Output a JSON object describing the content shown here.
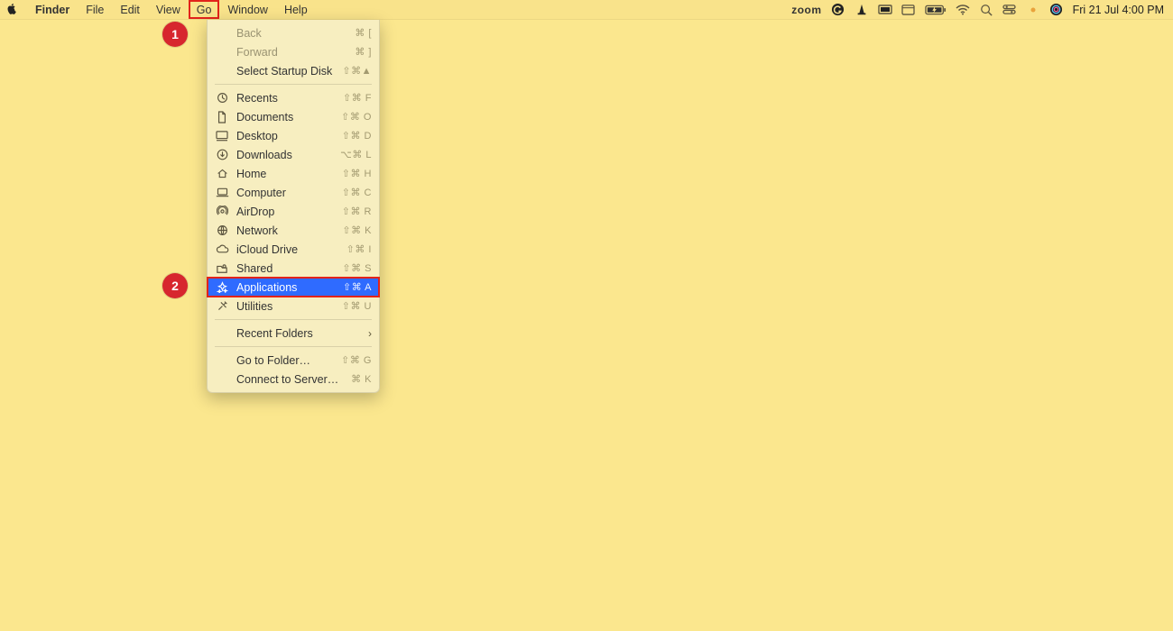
{
  "menubar": {
    "app": "Finder",
    "items": [
      "File",
      "Edit",
      "View",
      "Go",
      "Window",
      "Help"
    ],
    "status": {
      "zoom": "zoom",
      "clock": "Fri 21 Jul  4:00 PM"
    }
  },
  "dropdown": {
    "items": [
      {
        "label": "Back",
        "shortcut": "⌘ [",
        "icon": "",
        "disabled": true
      },
      {
        "label": "Forward",
        "shortcut": "⌘ ]",
        "icon": "",
        "disabled": true
      },
      {
        "label": "Select Startup Disk",
        "shortcut": "⇧⌘▲",
        "icon": ""
      },
      {
        "sep": true
      },
      {
        "label": "Recents",
        "shortcut": "⇧⌘ F",
        "icon": "clock"
      },
      {
        "label": "Documents",
        "shortcut": "⇧⌘ O",
        "icon": "doc"
      },
      {
        "label": "Desktop",
        "shortcut": "⇧⌘ D",
        "icon": "desktop"
      },
      {
        "label": "Downloads",
        "shortcut": "⌥⌘ L",
        "icon": "download"
      },
      {
        "label": "Home",
        "shortcut": "⇧⌘ H",
        "icon": "home"
      },
      {
        "label": "Computer",
        "shortcut": "⇧⌘ C",
        "icon": "laptop"
      },
      {
        "label": "AirDrop",
        "shortcut": "⇧⌘ R",
        "icon": "airdrop"
      },
      {
        "label": "Network",
        "shortcut": "⇧⌘ K",
        "icon": "globe"
      },
      {
        "label": "iCloud Drive",
        "shortcut": "⇧⌘ I",
        "icon": "cloud"
      },
      {
        "label": "Shared",
        "shortcut": "⇧⌘ S",
        "icon": "shared"
      },
      {
        "label": "Applications",
        "shortcut": "⇧⌘ A",
        "icon": "apps",
        "selected": true,
        "outlined": true
      },
      {
        "label": "Utilities",
        "shortcut": "⇧⌘ U",
        "icon": "tools"
      },
      {
        "sep": true
      },
      {
        "label": "Recent Folders",
        "shortcut": "",
        "icon": "",
        "submenu": true
      },
      {
        "sep": true
      },
      {
        "label": "Go to Folder…",
        "shortcut": "⇧⌘ G",
        "icon": ""
      },
      {
        "label": "Connect to Server…",
        "shortcut": "⌘ K",
        "icon": ""
      }
    ]
  },
  "badges": {
    "one": "1",
    "two": "2"
  }
}
